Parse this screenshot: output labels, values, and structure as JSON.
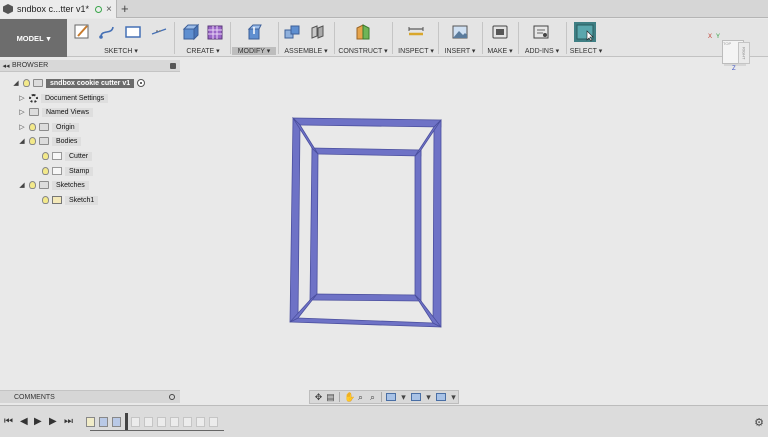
{
  "tab": {
    "title": "sndbox c...tter v1*",
    "new_tab": "+",
    "close": "×"
  },
  "toolbar": {
    "mode": "MODEL",
    "groups": [
      "SKETCH",
      "CREATE",
      "MODIFY",
      "ASSEMBLE",
      "CONSTRUCT",
      "INSPECT",
      "INSERT",
      "MAKE",
      "ADD-INS",
      "SELECT"
    ]
  },
  "viewcube": {
    "top": "TOP",
    "right": "RIGHT",
    "x": "X",
    "y": "Y",
    "z": "Z"
  },
  "browser": {
    "title": "BROWSER",
    "root": "sndbox cookie cutter v1",
    "items": [
      {
        "label": "Document Settings"
      },
      {
        "label": "Named Views"
      },
      {
        "label": "Origin"
      },
      {
        "label": "Bodies"
      },
      {
        "label": "Cutter"
      },
      {
        "label": "Stamp"
      },
      {
        "label": "Sketches"
      },
      {
        "label": "Sketch1"
      }
    ]
  },
  "comments": {
    "title": "COMMENTS"
  },
  "model": {
    "edge_color": "#5a5fb0",
    "face_color": "#7074c8"
  },
  "accent": {
    "select_tool": "#3f7f84",
    "bulb": "#f3e98a"
  }
}
